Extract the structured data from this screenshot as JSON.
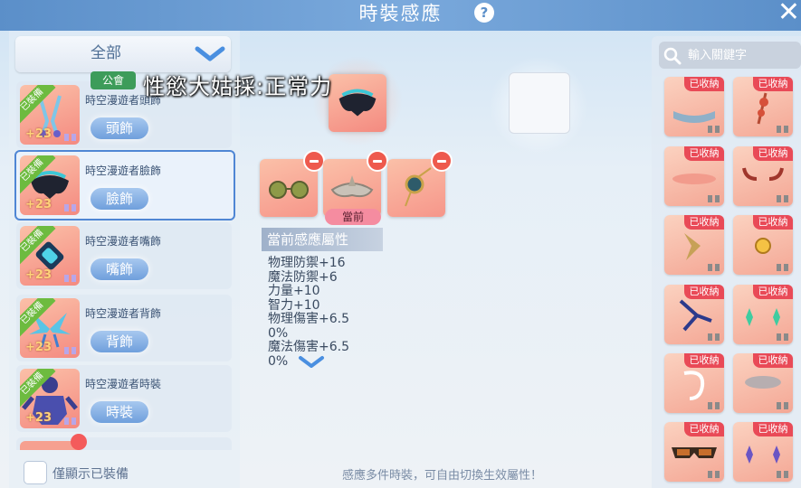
{
  "header": {
    "title": "時裝感應",
    "help_icon": "question-circle-icon",
    "close_icon": "close-icon"
  },
  "filter": {
    "label": "全部",
    "icon": "chevron-down-icon"
  },
  "equip_list": [
    {
      "badge": "已裝備",
      "name": "時空漫遊者頭飾",
      "slot": "頭飾",
      "level": "+23"
    },
    {
      "badge": "已裝備",
      "name": "時空漫遊者臉飾",
      "slot": "臉飾",
      "level": "+23",
      "selected": true
    },
    {
      "badge": "已裝備",
      "name": "時空漫遊者嘴飾",
      "slot": "嘴飾",
      "level": "+23"
    },
    {
      "badge": "已裝備",
      "name": "時空漫遊者背飾",
      "slot": "背飾",
      "level": "+23"
    },
    {
      "badge": "已裝備",
      "name": "時空漫遊者時裝",
      "slot": "時裝",
      "level": "+23"
    }
  ],
  "show_equipped_only": {
    "label": "僅顯示已裝備",
    "checked": false
  },
  "chat": {
    "channel": "公會",
    "message": "性慾大姑採:正常力"
  },
  "induction": {
    "current_tag": "當前"
  },
  "attributes": {
    "header": "當前感應屬性",
    "lines": [
      "物理防禦+16",
      "魔法防禦+6",
      "力量+10",
      "智力+10",
      "物理傷害+6.5",
      "0%",
      "魔法傷害+6.5",
      "0%"
    ]
  },
  "footer_tip": "感應多件時裝，可自由切換生效屬性！",
  "search": {
    "placeholder": "輸入關鍵字",
    "icon": "search-icon"
  },
  "collection": {
    "tag": "已收納",
    "items": [
      "band-headwear-icon",
      "red-charm-icon",
      "blush-face-icon",
      "demon-horns-icon",
      "golden-wing-icon",
      "medal-pin-icon",
      "blue-dagger-wing-icon",
      "green-earrings-icon",
      "white-ribbon-icon",
      "cloud-hat-icon",
      "brown-goggles-icon",
      "purple-earrings-icon"
    ]
  },
  "colors": {
    "title_bar": "#5b8fc9",
    "accent_blue": "#4f86d4",
    "equipped_green": "#6dbb3f",
    "collected_red": "#e94a57"
  }
}
